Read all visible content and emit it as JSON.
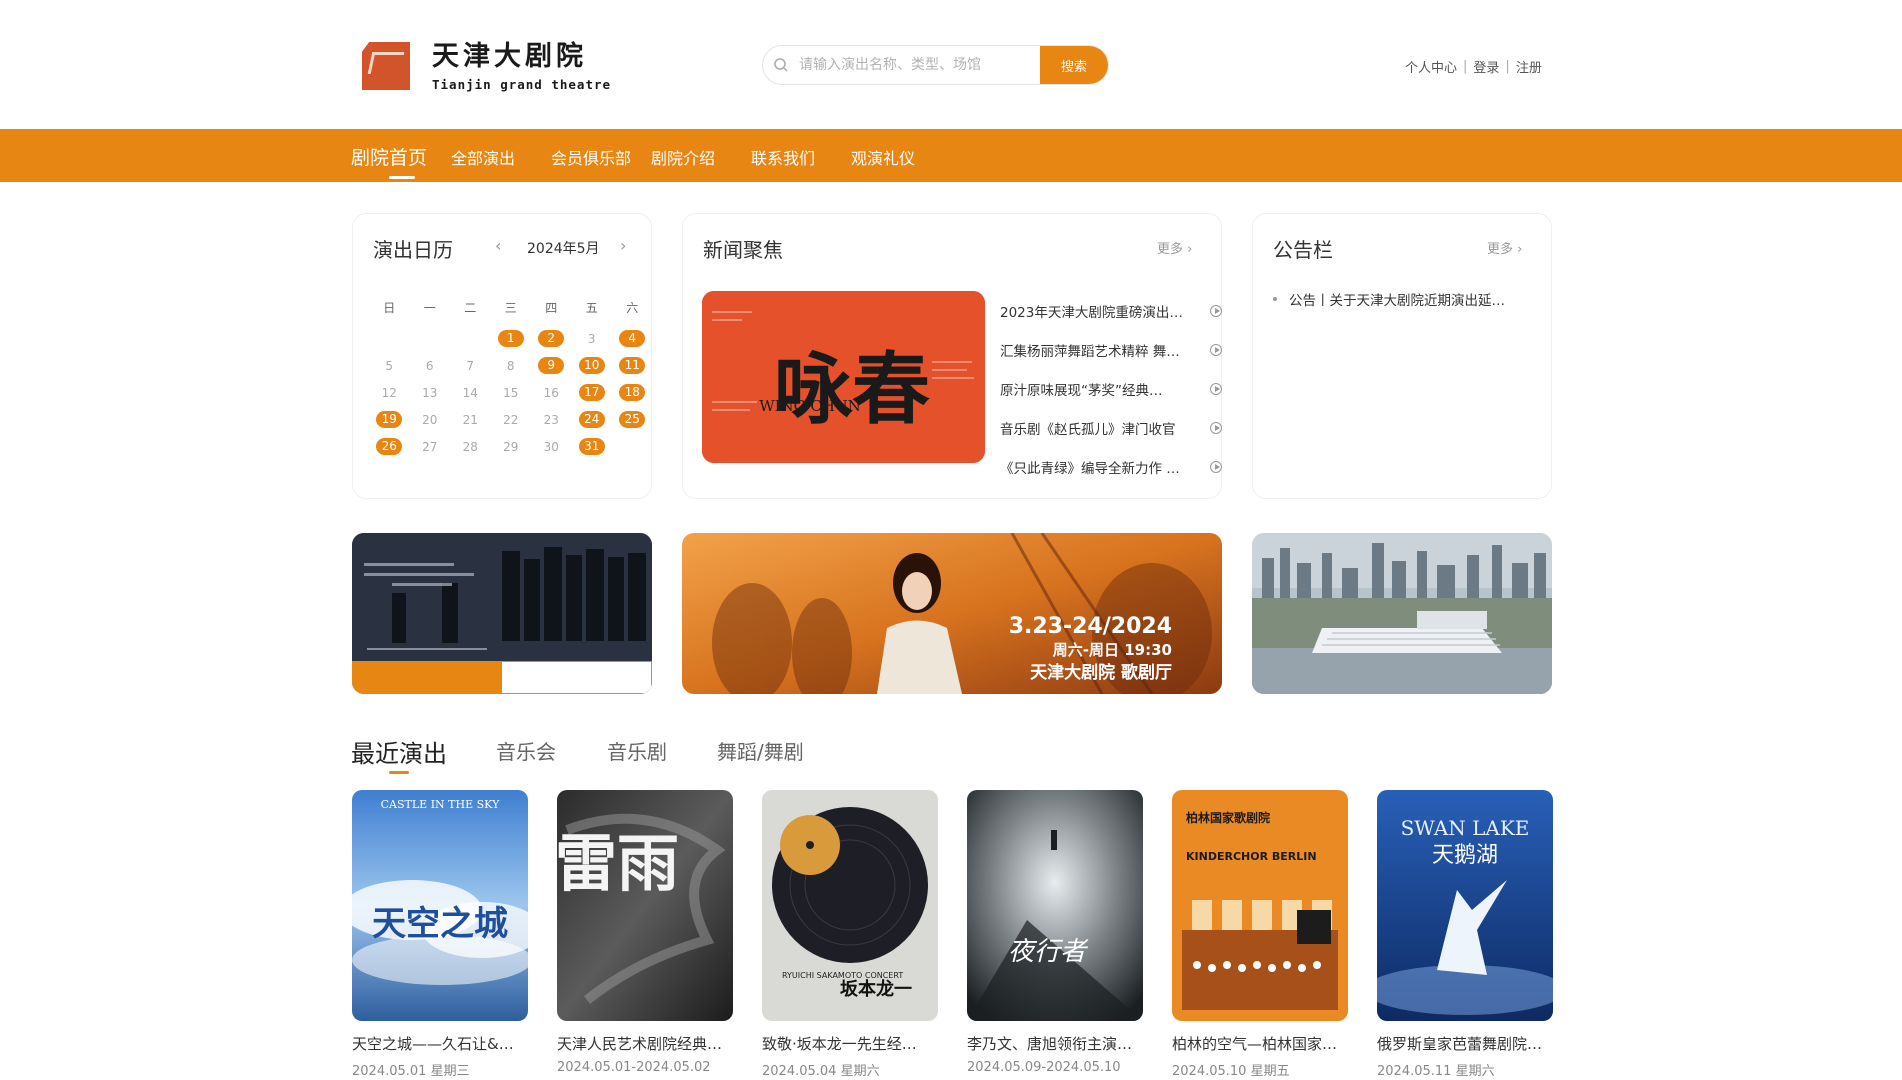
{
  "site": {
    "name_cn": "天津大剧院",
    "name_en": "Tianjin grand theatre"
  },
  "search": {
    "placeholder": "请输入演出名称、类型、场馆",
    "button_label": "搜索"
  },
  "user_links": [
    "个人中心",
    "登录",
    "注册"
  ],
  "nav": {
    "items": [
      "剧院首页",
      "全部演出",
      "会员俱乐部",
      "剧院介绍",
      "联系我们",
      "观演礼仪"
    ],
    "active_index": 0
  },
  "calendar": {
    "title": "演出日历",
    "month_label": "2024年5月",
    "weekdays": [
      "日",
      "一",
      "二",
      "三",
      "四",
      "五",
      "六"
    ],
    "weeks": [
      [
        "",
        "",
        "",
        "1",
        "2",
        "3",
        "4"
      ],
      [
        "5",
        "6",
        "7",
        "8",
        "9",
        "10",
        "11"
      ],
      [
        "12",
        "13",
        "14",
        "15",
        "16",
        "17",
        "18"
      ],
      [
        "19",
        "20",
        "21",
        "22",
        "23",
        "24",
        "25"
      ],
      [
        "26",
        "27",
        "28",
        "29",
        "30",
        "31",
        ""
      ]
    ],
    "highlighted_days": [
      "1",
      "2",
      "4",
      "9",
      "10",
      "11",
      "17",
      "18",
      "19",
      "24",
      "25",
      "26",
      "31"
    ]
  },
  "news": {
    "title": "新闻聚焦",
    "more_label": "更多",
    "featured_image": {
      "title_cn": "咏春",
      "title_en": "WING CHUN"
    },
    "items": [
      "2023年天津大剧院重磅演出…",
      "汇集杨丽萍舞蹈艺术精粹 舞…",
      "原汁原味展现“茅奖”经典…",
      "音乐剧《赵氏孤儿》津门收官",
      "《只此青绿》编导全新力作 …"
    ]
  },
  "notice": {
    "title": "公告栏",
    "more_label": "更多",
    "items": [
      "公告丨关于天津大剧院近期演出延…"
    ]
  },
  "banners": {
    "middle": {
      "date": "3.23-24/2024",
      "time": "周六-周日 19:30",
      "venue": "天津大剧院 歌剧厅"
    }
  },
  "recent": {
    "tabs": [
      "最近演出",
      "音乐会",
      "音乐剧",
      "舞蹈/舞剧"
    ],
    "active_index": 0,
    "shows": [
      {
        "title": "天空之城——久石让&…",
        "date": "2024.05.01 星期三",
        "poster_text": "天空之城",
        "poster_sub": "CASTLE IN THE SKY"
      },
      {
        "title": "天津人民艺术剧院经典…",
        "date": "2024.05.01-2024.05.02",
        "poster_text": "雷雨",
        "poster_sub": ""
      },
      {
        "title": "致敬·坂本龙一先生经…",
        "date": "2024.05.04 星期六",
        "poster_text": "坂本龙一",
        "poster_sub": "RYUICHI SAKAMOTO CONCERT"
      },
      {
        "title": "李乃文、唐旭领衔主演…",
        "date": "2024.05.09-2024.05.10",
        "poster_text": "夜行者",
        "poster_sub": ""
      },
      {
        "title": "柏林的空气—柏林国家…",
        "date": "2024.05.10 星期五",
        "poster_text": "柏林国家歌剧院",
        "poster_sub": "KINDERCHOR BERLIN"
      },
      {
        "title": "俄罗斯皇家芭蕾舞剧院…",
        "date": "2024.05.11 星期六",
        "poster_text": "天鹅湖",
        "poster_sub": "SWAN LAKE"
      }
    ]
  },
  "colors": {
    "accent": "#e88613",
    "news_red": "#e5512a"
  }
}
